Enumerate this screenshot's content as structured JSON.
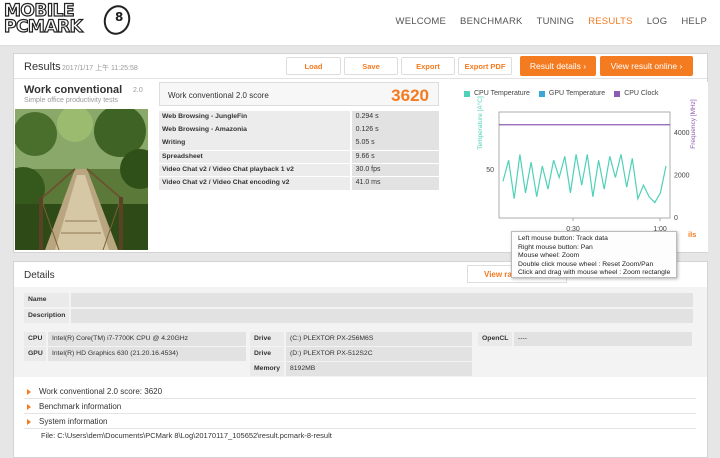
{
  "app": {
    "logo_line1": "MOBILE",
    "logo_line2": "PCMARK",
    "logo_number": "8"
  },
  "nav": [
    "WELCOME",
    "BENCHMARK",
    "TUNING",
    "RESULTS",
    "LOG",
    "HELP"
  ],
  "nav_active": "RESULTS",
  "results": {
    "title": "Results",
    "date": "2017/1/17 上午 11:25:58",
    "buttons": {
      "load": "Load",
      "save": "Save",
      "export": "Export",
      "export_pdf": "Export PDF",
      "result_details": "Result details",
      "view_online": "View result online"
    },
    "benchmark_name": "Work conventional",
    "benchmark_version": "2.0",
    "benchmark_desc": "Simple office productivity tests",
    "score_label": "Work conventional 2.0 score",
    "score_value": "3620",
    "subscores": [
      {
        "name": "Web Browsing - JungleFin",
        "value": "0.294 s"
      },
      {
        "name": "Web Browsing - Amazonia",
        "value": "0.126 s"
      },
      {
        "name": "Writing",
        "value": "5.05 s"
      },
      {
        "name": "Spreadsheet",
        "value": "9.66 s"
      },
      {
        "name": "Video Chat v2 / Video Chat playback 1 v2",
        "value": "30.0 fps"
      },
      {
        "name": "Video Chat v2 / Video Chat encoding v2",
        "value": "41.0 ms"
      }
    ]
  },
  "chart_data": {
    "type": "line",
    "legend": [
      "CPU Temperature",
      "GPU Temperature",
      "CPU Clock"
    ],
    "colors": {
      "cpu_temp": "#4fd1b7",
      "gpu_temp": "#3aa7d6",
      "cpu_clock": "#8e5bb4",
      "accent": "#f47b20"
    },
    "left_axis_label": "Temperature [A°C]",
    "right_axis_label": "Frequency [MHz]",
    "left_ticks": [
      "50"
    ],
    "right_ticks": [
      "4000",
      "2000",
      "0"
    ],
    "x_ticks": [
      "0:30",
      "1:00"
    ],
    "cpu_temp_series": [
      44,
      55,
      35,
      58,
      38,
      54,
      36,
      52,
      40,
      55,
      46,
      57,
      38,
      58,
      42,
      58,
      36,
      55,
      40,
      57,
      46,
      58,
      41,
      56,
      35,
      42,
      36,
      33,
      38,
      52
    ],
    "cpu_clock_series": [
      4400,
      4400
    ],
    "left_ylim": [
      25,
      80
    ],
    "right_ylim": [
      0,
      5000
    ],
    "partial_button": "ils"
  },
  "tooltip": [
    "Left mouse button: Track data",
    "Right mouse button: Pan",
    "Mouse wheel: Zoom",
    "Double click mouse wheel : Reset Zoom/Pan",
    "Click and drag with mouse wheel : Zoom rectangle"
  ],
  "details": {
    "title": "Details",
    "view_raw": "View ra",
    "name_label": "Name",
    "name_value": "",
    "description_label": "Description",
    "description_value": "",
    "cpu_label": "CPU",
    "cpu_value": "Intel(R) Core(TM) i7-7700K CPU @ 4.20GHz",
    "gpu_label": "GPU",
    "gpu_value": "Intel(R) HD Graphics 630 (21.20.16.4534)",
    "drive_label": "Drive",
    "drive1_value": "(C:) PLEXTOR PX-256M6S",
    "drive2_value": "(D:) PLEXTOR PX-512S2C",
    "memory_label": "Memory",
    "memory_value": "8192MB",
    "opencl_label": "OpenCL",
    "opencl_value": "----",
    "accordion": [
      "Work conventional 2.0 score: 3620",
      "Benchmark information",
      "System information"
    ],
    "file_path": "File: C:\\Users\\dem\\Documents\\PCMark 8\\Log\\20170117_105652\\result.pcmark-8-result"
  }
}
